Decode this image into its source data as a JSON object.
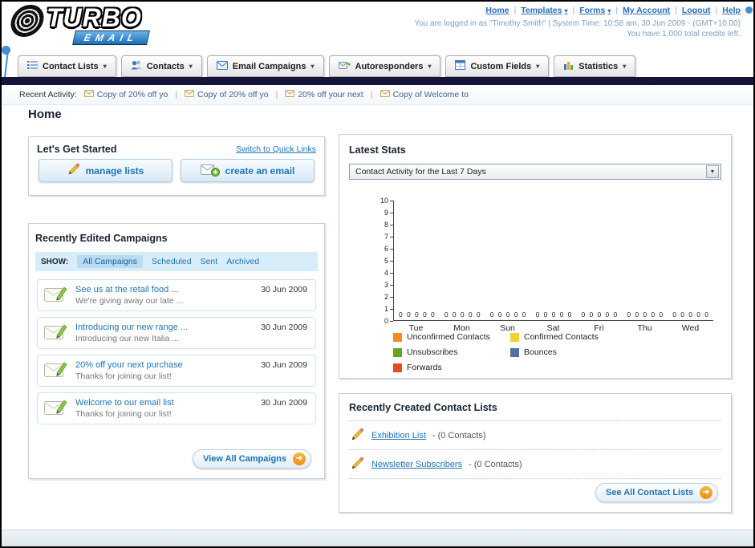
{
  "header": {
    "logo_title": "TURBO",
    "logo_subtitle": "EMAIL",
    "nav_links": [
      "Home",
      "Templates",
      "Forms",
      "My Account",
      "Logout",
      "Help"
    ],
    "login_info": "You are logged in as \"Timothy Smith\" | System Time: 10:58 am, 30 Jun 2009 - (GMT+10:00)",
    "credits_info": "You have 1,000 total credits left."
  },
  "icons": {
    "chevron_down": "▾",
    "select_arrow": "▼",
    "arrow_right": "➜"
  },
  "colors": {
    "link": "#1c74b8",
    "navbar": "#14143c",
    "accent_orange": "#ee8d12"
  },
  "nav_tabs": [
    {
      "label": "Contact Lists"
    },
    {
      "label": "Contacts"
    },
    {
      "label": "Email Campaigns"
    },
    {
      "label": "Autoresponders"
    },
    {
      "label": "Custom Fields"
    },
    {
      "label": "Statistics"
    }
  ],
  "recent_activity": {
    "label": "Recent Activity:",
    "items": [
      "Copy of 20% off yo",
      "Copy of 20% off yo",
      "20% off your next",
      "Copy of Welcome to"
    ]
  },
  "page_title": "Home",
  "get_started": {
    "title": "Let's Get Started",
    "switch_link": "Switch to Quick Links",
    "buttons": [
      {
        "label": "manage lists"
      },
      {
        "label": "create an email"
      }
    ]
  },
  "campaigns": {
    "title": "Recently Edited Campaigns",
    "show_label": "SHOW:",
    "tabs": [
      "All Campaigns",
      "Scheduled",
      "Sent",
      "Archived"
    ],
    "items": [
      {
        "title": "See us at the retail food ...",
        "subtitle": "We're giving away our late ...",
        "date": "30 Jun 2009"
      },
      {
        "title": "Introducing our new range ...",
        "subtitle": "Introducing our new Italia ...",
        "date": "30 Jun 2009"
      },
      {
        "title": "20% off your next purchase",
        "subtitle": "Thanks for joining our list!",
        "date": "30 Jun 2009"
      },
      {
        "title": "Welcome to our email list",
        "subtitle": "Thanks for joining our list!",
        "date": "30 Jun 2009"
      }
    ],
    "view_all_label": "View All Campaigns"
  },
  "stats": {
    "title": "Latest Stats",
    "dropdown_value": "Contact Activity for the Last 7 Days"
  },
  "chart_data": {
    "type": "bar",
    "categories": [
      "Tue",
      "Mon",
      "Sun",
      "Sat",
      "Fri",
      "Thu",
      "Wed"
    ],
    "series": [
      {
        "name": "Unconfirmed Contacts",
        "color": "#f28a28",
        "values": [
          0,
          0,
          0,
          0,
          0,
          0,
          0
        ]
      },
      {
        "name": "Confirmed Contacts",
        "color": "#f7cf33",
        "values": [
          0,
          0,
          0,
          0,
          0,
          0,
          0
        ]
      },
      {
        "name": "Unsubscribes",
        "color": "#67a421",
        "values": [
          0,
          0,
          0,
          0,
          0,
          0,
          0
        ]
      },
      {
        "name": "Bounces",
        "color": "#4f6fa6",
        "values": [
          0,
          0,
          0,
          0,
          0,
          0,
          0
        ]
      },
      {
        "name": "Forwards",
        "color": "#e04f23",
        "values": [
          0,
          0,
          0,
          0,
          0,
          0,
          0
        ]
      }
    ],
    "title": "Contact Activity for the Last 7 Days",
    "xlabel": "",
    "ylabel": "",
    "ylim": [
      0,
      10
    ],
    "yticks": [
      0,
      1,
      2,
      3,
      4,
      5,
      6,
      7,
      8,
      9,
      10
    ],
    "legend_position": "bottom",
    "grid": false
  },
  "contact_lists": {
    "title": "Recently Created Contact Lists",
    "items": [
      {
        "name": "Exhibition List",
        "count": "- (0 Contacts)"
      },
      {
        "name": "Newsletter Subscribers",
        "count": "- (0 Contacts)"
      }
    ],
    "see_all_label": "See All Contact Lists"
  }
}
